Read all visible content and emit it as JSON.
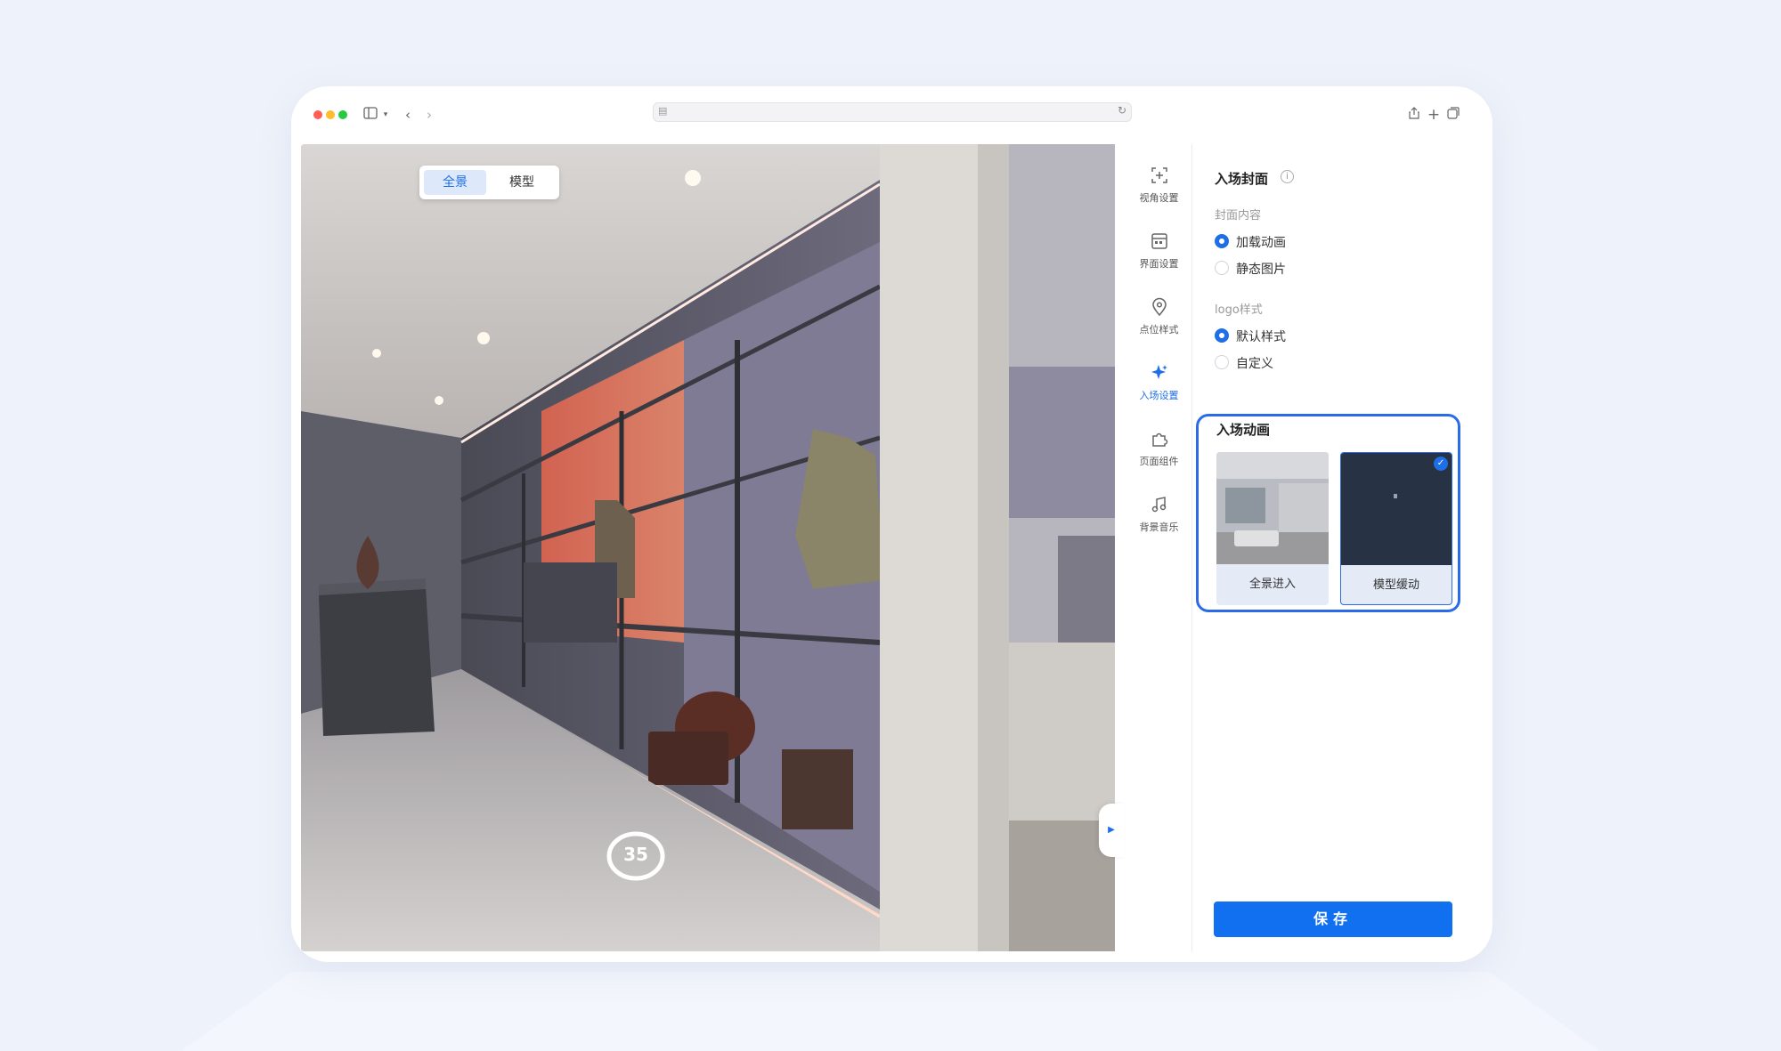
{
  "viewport": {
    "view_toggle": {
      "options": [
        "全景",
        "模型"
      ],
      "selected": "全景"
    },
    "hotspot_label": "35"
  },
  "sidebar": {
    "items": [
      {
        "label": "视角设置",
        "icon": "viewpoint-icon"
      },
      {
        "label": "界面设置",
        "icon": "interface-icon"
      },
      {
        "label": "点位样式",
        "icon": "location-pin-icon"
      },
      {
        "label": "入场设置",
        "icon": "sparkle-icon",
        "active": true
      },
      {
        "label": "页面组件",
        "icon": "puzzle-icon"
      },
      {
        "label": "背景音乐",
        "icon": "music-note-icon"
      }
    ]
  },
  "panel": {
    "title": "入场封面",
    "cover_content": {
      "label": "封面内容",
      "options": [
        "加载动画",
        "静态图片"
      ],
      "selected": "加载动画"
    },
    "logo_style": {
      "label": "logo样式",
      "options": [
        "默认样式",
        "自定义"
      ],
      "selected": "默认样式"
    },
    "entry_animation": {
      "title": "入场动画",
      "cards": [
        {
          "label": "全景进入",
          "selected": false
        },
        {
          "label": "模型缓动",
          "selected": true
        }
      ]
    },
    "save_label": "保存"
  },
  "colors": {
    "accent": "#1e6ee8",
    "button": "#1170f0",
    "highlight_border": "#2b6bea",
    "page_bg": "#eef2fa"
  }
}
